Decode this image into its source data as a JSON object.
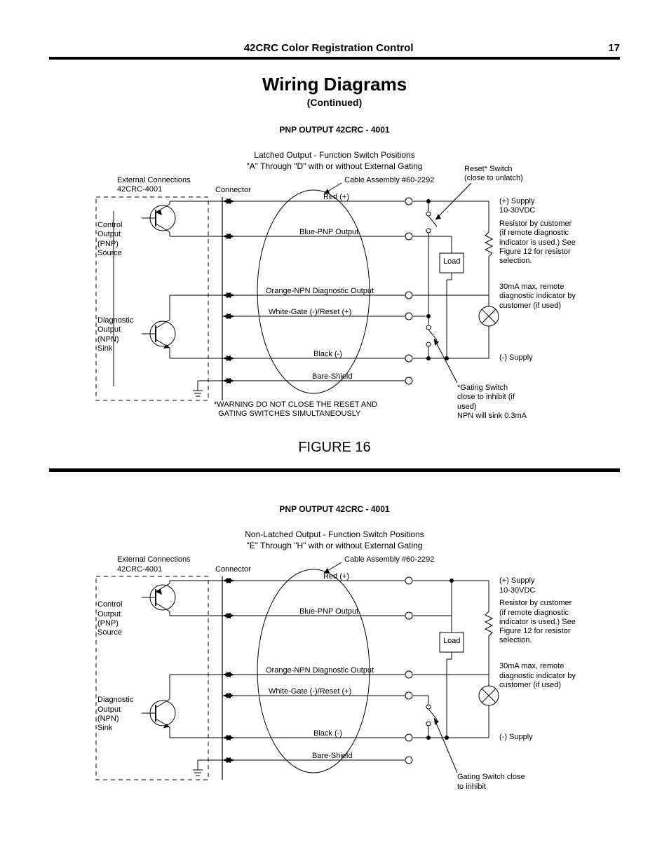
{
  "header": {
    "title": "42CRC Color Registration Control",
    "page": "17"
  },
  "section": {
    "title": "Wiring Diagrams",
    "subtitle": "(Continued)"
  },
  "fig16": {
    "subheading": "PNP OUTPUT 42CRC - 4001",
    "opt_line1": "Latched Output - Function Switch Positions",
    "opt_line2": "\"A\" Through \"D\"  with or without External Gating",
    "ext_conn_line1": "External Connections",
    "ext_conn_line2": "42CRC-4001",
    "connector": "Connector",
    "control_out": "Control\nOutput\n(PNP)\nSource",
    "diag_out": "Diagnostic\nOutput\n(NPN)\nSink",
    "red": "Red  (+)",
    "blue": "Blue-PNP Output",
    "orange": "Orange-NPN Diagnostic Output",
    "white": "White-Gate (-)/Reset (+)",
    "black": "Black (-)",
    "bare": "Bare-Shield",
    "cable": "Cable Assembly #60-2292",
    "load": "Load",
    "reset_sw": "Reset* Switch\n(close to unlatch)",
    "supply_pos": "(+) Supply\n10-30VDC",
    "resistor_note": "Resistor by customer (if remote diagnostic indicator is used.) See Figure 12 for resistor selection.",
    "diag_ind": "30mA max, remote diagnostic indicator by customer (if used)",
    "supply_neg": "(-) Supply",
    "gating_note": "*Gating Switch close to inhibit (if used)\nNPN will sink 0.3mA",
    "warning": "*WARNING DO NOT CLOSE THE RESET AND\n  GATING SWITCHES SIMULTANEOUSLY",
    "caption": "FIGURE 16"
  },
  "fig17": {
    "subheading": "PNP OUTPUT 42CRC - 4001",
    "opt_line1": "Non-Latched Output - Function Switch Positions",
    "opt_line2": "\"E\" Through \"H\"  with or without External Gating",
    "ext_conn_line1": "External Connections",
    "ext_conn_line2": "42CRC-4001",
    "connector": "Connector",
    "control_out": "Control\nOutput\n(PNP)\nSource",
    "diag_out": "Diagnostic\nOutput\n(NPN)\nSink",
    "red": "Red  (+)",
    "blue": "Blue-PNP Output",
    "orange": "Orange-NPN Diagnostic Output",
    "white": "White-Gate (-)/Reset (+)",
    "black": "Black (-)",
    "bare": "Bare-Shield",
    "cable": "Cable Assembly #60-2292",
    "load": "Load",
    "supply_pos": "(+) Supply\n10-30VDC",
    "resistor_note": "Resistor by customer (if remote diagnostic indicator is used.) See Figure 12 for resistor selection.",
    "diag_ind": "30mA max, remote diagnostic indicator by customer (if used)",
    "supply_neg": "(-) Supply",
    "gating_note": "Gating Switch close to inhibit",
    "caption_cut": ""
  }
}
